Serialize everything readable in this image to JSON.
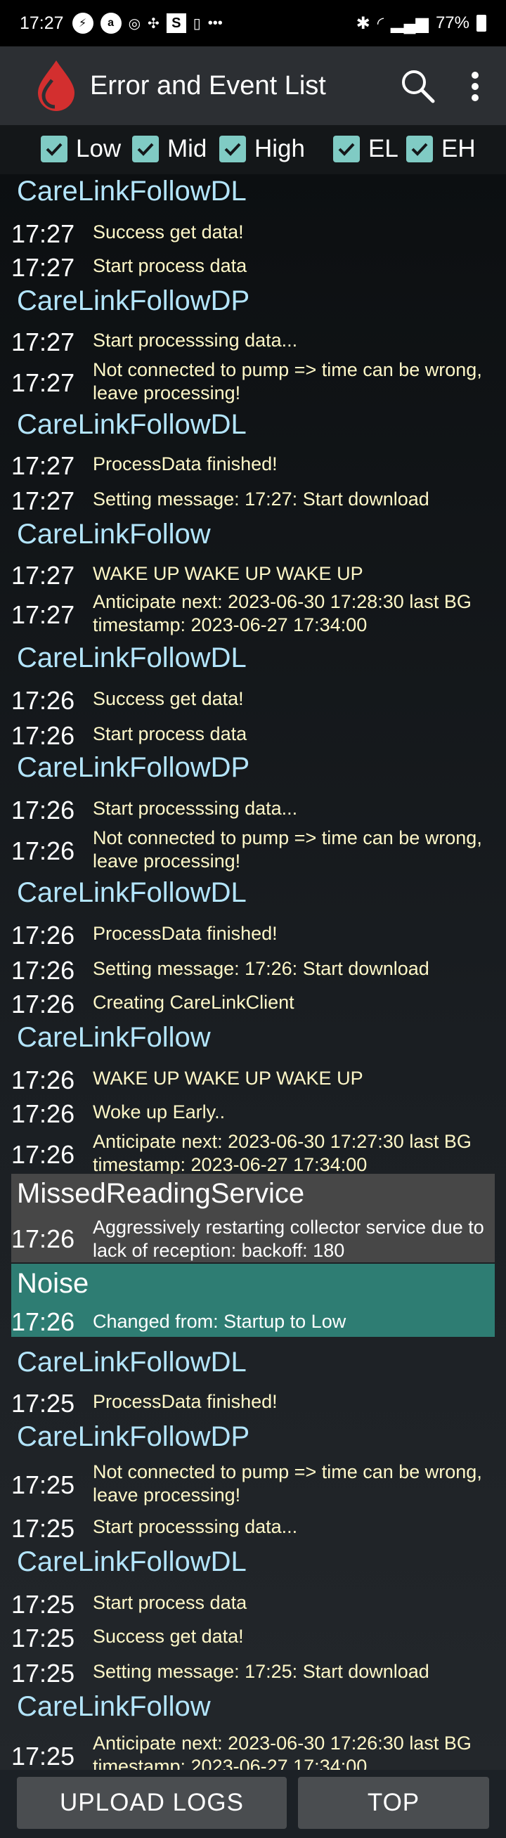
{
  "status_bar": {
    "time": "17:27",
    "battery": "77%",
    "icons": [
      "flash-icon",
      "abbott-icon",
      "gps-icon",
      "dots-icon",
      "s-icon",
      "battery-saver-icon",
      "more-icon",
      "bluetooth-icon",
      "wifi-icon",
      "signal-icon",
      "battery-icon"
    ]
  },
  "app_bar": {
    "title": "Error and Event List"
  },
  "filters": [
    {
      "label": "Low",
      "checked": true
    },
    {
      "label": "Mid",
      "checked": true
    },
    {
      "label": "High",
      "checked": true
    },
    {
      "label": "EL",
      "checked": true
    },
    {
      "label": "EH",
      "checked": true
    }
  ],
  "log": [
    {
      "source": "CareLinkFollowDL"
    },
    {
      "time": "17:27",
      "message": "Success get data!"
    },
    {
      "time": "17:27",
      "message": "Start process data"
    },
    {
      "source": "CareLinkFollowDP"
    },
    {
      "time": "17:27",
      "message": "Start processsing data..."
    },
    {
      "time": "17:27",
      "message": "Not connected to pump => time can be wrong, leave processing!"
    },
    {
      "source": "CareLinkFollowDL"
    },
    {
      "time": "17:27",
      "message": "ProcessData finished!"
    },
    {
      "time": "17:27",
      "message": "Setting message: 17:27: Start download"
    },
    {
      "source": "CareLinkFollow"
    },
    {
      "time": "17:27",
      "message": "WAKE UP WAKE UP WAKE UP"
    },
    {
      "time": "17:27",
      "message": "Anticipate next: 2023-06-30 17:28:30  last BG timestamp: 2023-06-27 17:34:00"
    },
    {
      "source": "CareLinkFollowDL"
    },
    {
      "time": "17:26",
      "message": "Success get data!"
    },
    {
      "time": "17:26",
      "message": "Start process data"
    },
    {
      "source": "CareLinkFollowDP"
    },
    {
      "time": "17:26",
      "message": "Start processsing data..."
    },
    {
      "time": "17:26",
      "message": "Not connected to pump => time can be wrong, leave processing!"
    },
    {
      "source": "CareLinkFollowDL"
    },
    {
      "time": "17:26",
      "message": "ProcessData finished!"
    },
    {
      "time": "17:26",
      "message": "Setting message: 17:26: Start download"
    },
    {
      "time": "17:26",
      "message": "Creating CareLinkClient"
    },
    {
      "source": "CareLinkFollow"
    },
    {
      "time": "17:26",
      "message": "WAKE UP WAKE UP WAKE UP"
    },
    {
      "time": "17:26",
      "message": "Woke up Early.."
    },
    {
      "time": "17:26",
      "message": "Anticipate next: 2023-06-30 17:27:30  last BG timestamp: 2023-06-27 17:34:00"
    },
    {
      "source": "MissedReadingService",
      "level": "high"
    },
    {
      "time": "17:26",
      "message": "Aggressively restarting collector service due to lack of reception: backoff: 180",
      "level": "high"
    },
    {
      "source": "Noise",
      "level": "noise"
    },
    {
      "time": "17:26",
      "message": "Changed from: Startup to Low",
      "level": "noise"
    },
    {
      "source": "CareLinkFollowDL"
    },
    {
      "time": "17:25",
      "message": "ProcessData finished!"
    },
    {
      "source": "CareLinkFollowDP"
    },
    {
      "time": "17:25",
      "message": "Not connected to pump => time can be wrong, leave processing!"
    },
    {
      "time": "17:25",
      "message": "Start processsing data..."
    },
    {
      "source": "CareLinkFollowDL"
    },
    {
      "time": "17:25",
      "message": "Start process data"
    },
    {
      "time": "17:25",
      "message": "Success get data!"
    },
    {
      "time": "17:25",
      "message": "Setting message: 17:25: Start download"
    },
    {
      "source": "CareLinkFollow"
    },
    {
      "time": "17:25",
      "message": "Anticipate next: 2023-06-30 17:26:30  last BG timestamp: 2023-06-27 17:34:00"
    }
  ],
  "buttons": {
    "upload_logs": "UPLOAD LOGS",
    "top": "TOP"
  },
  "colors": {
    "source_header": "#b3e5fc",
    "message_text": "#fff8c8",
    "checkbox": "#80cbc4",
    "missed_block": "#474747",
    "noise_block": "#2e7d73",
    "logo": "#d32f2f"
  }
}
